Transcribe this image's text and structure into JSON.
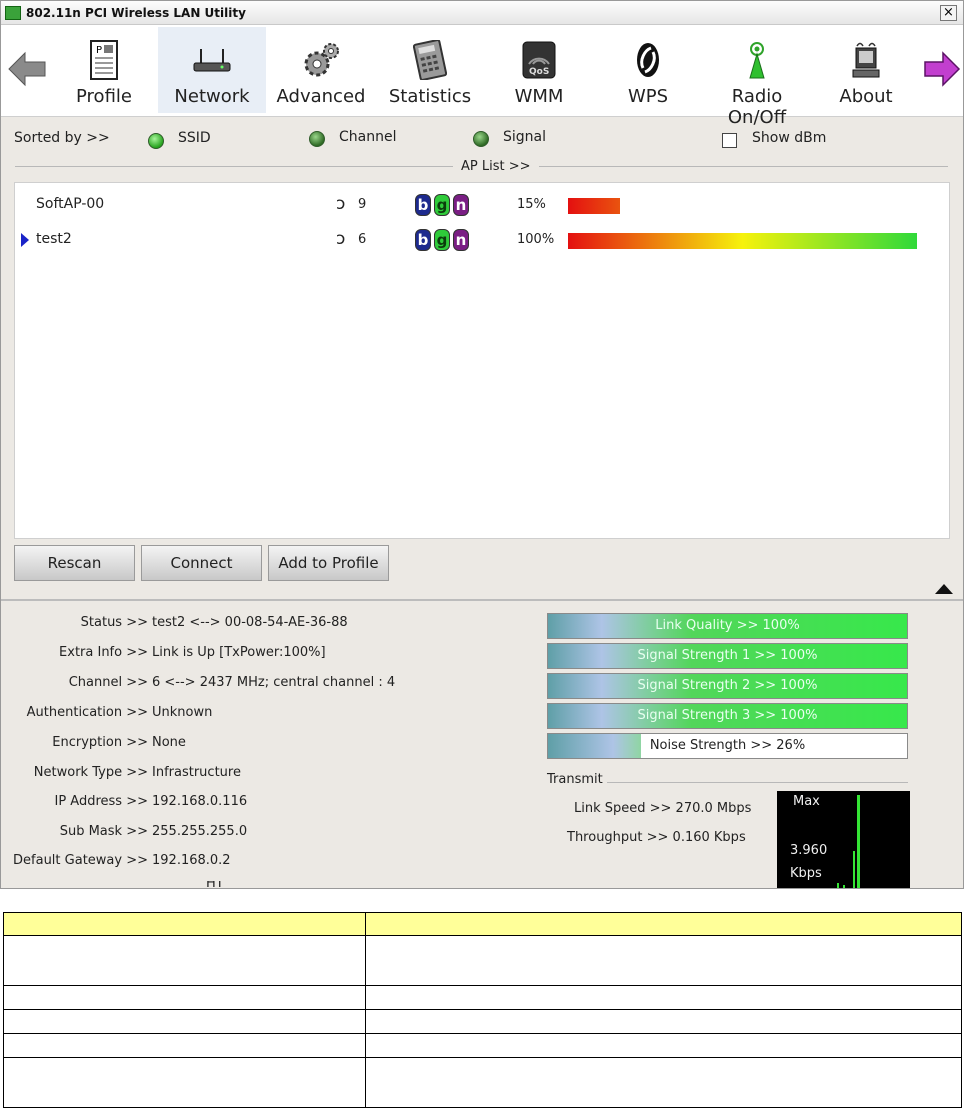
{
  "window": {
    "title": "802.11n PCI Wireless LAN Utility",
    "close_label": "×"
  },
  "toolbar": {
    "items": [
      {
        "label": "Profile",
        "icon": "profile-icon"
      },
      {
        "label": "Network",
        "icon": "network-icon"
      },
      {
        "label": "Advanced",
        "icon": "advanced-gear-icon"
      },
      {
        "label": "Statistics",
        "icon": "statistics-icon"
      },
      {
        "label": "WMM",
        "icon": "wmm-qos-icon"
      },
      {
        "label": "WPS",
        "icon": "wps-icon"
      },
      {
        "label": "Radio On/Off",
        "icon": "radio-antenna-icon"
      },
      {
        "label": "About",
        "icon": "about-icon"
      }
    ],
    "active": "Network"
  },
  "sort": {
    "label": "Sorted by >>",
    "options": [
      "SSID",
      "Channel",
      "Signal"
    ],
    "show_dbm_label": "Show dBm",
    "show_dbm_checked": false
  },
  "ap_list": {
    "title": "AP List >>",
    "rows": [
      {
        "ssid": "SoftAP-00",
        "channel": "9",
        "modes": [
          "b",
          "g",
          "n"
        ],
        "signal_text": "15%",
        "signal": 0.15,
        "selected": false
      },
      {
        "ssid": "test2",
        "channel": "6",
        "modes": [
          "b",
          "g",
          "n"
        ],
        "signal_text": "100%",
        "signal": 1.0,
        "selected": true
      }
    ]
  },
  "buttons": {
    "rescan": "Rescan",
    "connect": "Connect",
    "add_to_profile": "Add to Profile"
  },
  "info": [
    {
      "label": "Status >>",
      "value": "test2 <--> 00-08-54-AE-36-88"
    },
    {
      "label": "Extra Info >>",
      "value": "Link is Up [TxPower:100%]"
    },
    {
      "label": "Channel >>",
      "value": "6 <--> 2437 MHz; central channel : 4"
    },
    {
      "label": "Authentication >>",
      "value": "Unknown"
    },
    {
      "label": "Encryption >>",
      "value": "None"
    },
    {
      "label": "Network Type >>",
      "value": "Infrastructure"
    },
    {
      "label": "IP Address >>",
      "value": "192.168.0.116"
    },
    {
      "label": "Sub Mask >>",
      "value": "255.255.255.0"
    },
    {
      "label": "Default Gateway >>",
      "value": "192.168.0.2"
    }
  ],
  "info_partial": "HT",
  "quality": [
    {
      "label": "Link Quality >> 100%",
      "level": 1.0
    },
    {
      "label": "Signal Strength 1 >> 100%",
      "level": 1.0
    },
    {
      "label": "Signal Strength 2 >> 100%",
      "level": 1.0
    },
    {
      "label": "Signal Strength 3 >> 100%",
      "level": 1.0
    },
    {
      "label": "Noise Strength >> 26%",
      "level": 0.26
    }
  ],
  "transmit": {
    "title": "Transmit",
    "link_speed": "Link Speed >> 270.0 Mbps",
    "throughput": "Throughput >> 0.160 Kbps",
    "graph_max": "Max",
    "graph_value": "3.960",
    "graph_unit": "Kbps"
  },
  "colors": {
    "accent_green": "#35e535",
    "selected_pointer": "#1a23c8",
    "header_row": "#ffff99"
  }
}
